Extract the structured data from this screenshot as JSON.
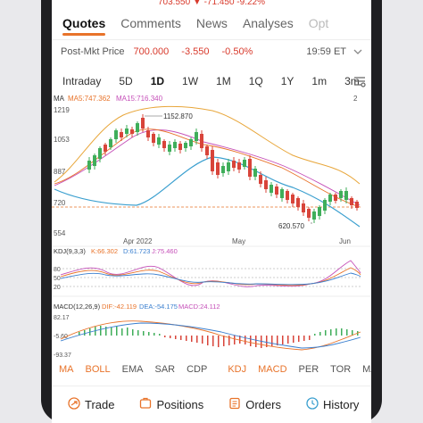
{
  "top_line": "703.550 ▼ -71.450 -9.22%",
  "tabs": [
    "Quotes",
    "Comments",
    "News",
    "Analyses",
    "Opt"
  ],
  "post_market": {
    "label": "Post-Mkt Price",
    "price": "700.000",
    "change": "-3.550",
    "percent": "-0.50%",
    "time": "19:59 ET"
  },
  "periods": [
    "Intraday",
    "5D",
    "1D",
    "1W",
    "1M",
    "1Q",
    "1Y",
    "1m",
    "3m"
  ],
  "colors": {
    "accent": "#e8732a",
    "up": "#3fae5a",
    "down": "#d8443a"
  },
  "chart": {
    "ma_legend": {
      "ma": "MA",
      "ma5": "MA5:747.362",
      "ma15": "MA15:716.340"
    },
    "corner_label": "2",
    "y_ticks": [
      "1219",
      "1053",
      "887",
      "720",
      "554"
    ],
    "high_label": "1152.870",
    "low_label": "620.570",
    "x_labels": [
      "Apr 2022",
      "May",
      "Jun"
    ],
    "kdj_legend": {
      "name": "KDJ(9,3,3)",
      "k": "K:66.302",
      "d": "D:61.723",
      "j": "J:75.460"
    },
    "kdj_ticks": [
      "80",
      "50",
      "20"
    ],
    "macd_legend": {
      "name": "MACD(12,26,9)",
      "dif": "DIF:-42.119",
      "dea": "DEA:-54.175",
      "macd": "MACD:24.112"
    },
    "macd_ticks": [
      "82.17",
      "-5.60",
      "-93.37"
    ]
  },
  "indicators": [
    "MA",
    "BOLL",
    "EMA",
    "SAR",
    "CDP",
    "KDJ",
    "MACD",
    "PER",
    "TOR",
    "MAVOL"
  ],
  "bottom": [
    "Trade",
    "Positions",
    "Orders",
    "History"
  ]
}
